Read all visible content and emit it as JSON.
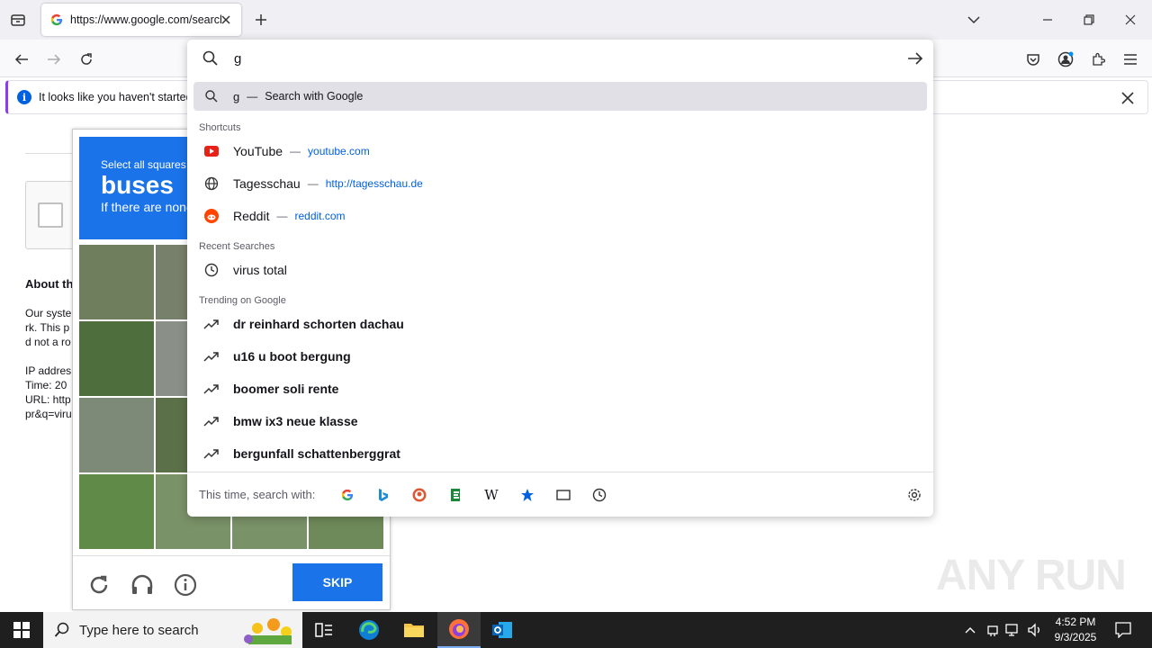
{
  "browser": {
    "tab_title": "https://www.google.com/search",
    "address_value": "g",
    "notice": "It looks like you haven't started"
  },
  "page": {
    "about_heading": "About th",
    "lines": [
      "Our syste",
      "rk. This p",
      "d not a ro",
      "IP addres",
      "Time: 20",
      "URL: http",
      "pr&q=viru"
    ]
  },
  "captcha": {
    "select_text": "Select all squares",
    "target": "buses",
    "sub_text": "If there are none",
    "skip_label": "SKIP"
  },
  "dropdown": {
    "first": {
      "query": "g",
      "action": "Search with Google"
    },
    "shortcuts_label": "Shortcuts",
    "shortcuts": [
      {
        "title": "YouTube",
        "url": "youtube.com",
        "icon": "youtube-icon"
      },
      {
        "title": "Tagesschau",
        "url": "http://tagesschau.de",
        "icon": "globe-icon"
      },
      {
        "title": "Reddit",
        "url": "reddit.com",
        "icon": "reddit-icon"
      }
    ],
    "recent_label": "Recent Searches",
    "recent": [
      "virus total"
    ],
    "trending_label": "Trending on Google",
    "trending": [
      "dr reinhard schorten dachau",
      "u16 u boot bergung",
      "boomer soli rente",
      "bmw ix3 neue klasse",
      "bergunfall schattenberggrat"
    ],
    "oneoff_label": "This time, search with:",
    "engines": [
      "google-icon",
      "bing-icon",
      "duckduckgo-icon",
      "ecosia-icon",
      "wikipedia-icon",
      "bookmarks-icon",
      "tabs-icon",
      "history-icon"
    ]
  },
  "watermark": "ANY RUN",
  "taskbar": {
    "search_placeholder": "Type here to search",
    "time": "4:52 PM",
    "date": "9/3/2025"
  }
}
